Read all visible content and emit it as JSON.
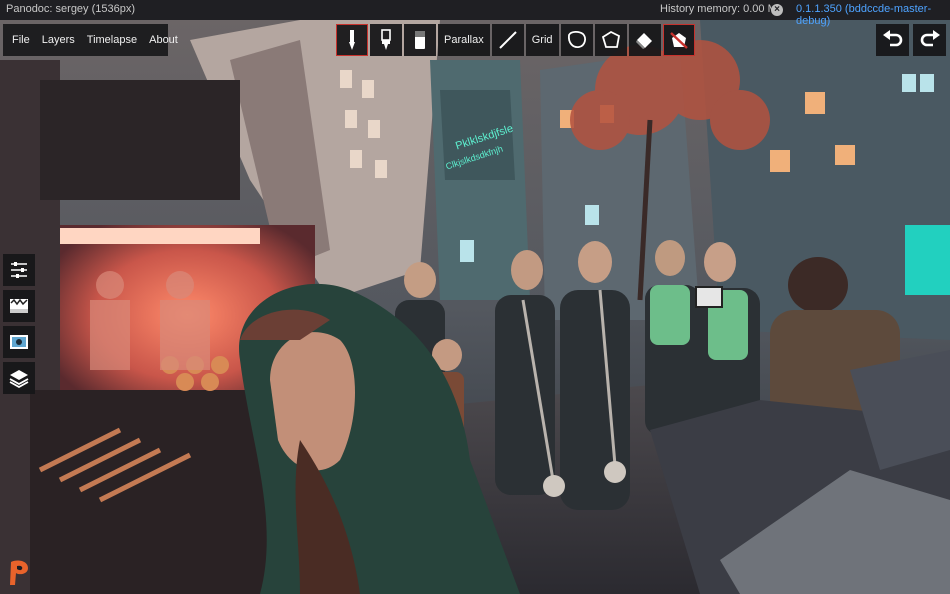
{
  "titlebar": {
    "app_title": "Panodoc: sergey (1536px)",
    "history_memory": "History memory: 0.00 Mb",
    "version": "0.1.1.350 (bddccde-master-debug)"
  },
  "menu": {
    "file": "File",
    "layers": "Layers",
    "timelapse": "Timelapse",
    "about": "About"
  },
  "toolbar": {
    "parallax": "Parallax",
    "grid": "Grid"
  },
  "artwork": {
    "sign_line1": "Pklklskdjfsle",
    "sign_line2": "Clkjslkdsdkfnjh"
  },
  "colors": {
    "active_border": "#c8322d",
    "version_text": "#4ea3ff",
    "logo": "#e8632b"
  }
}
